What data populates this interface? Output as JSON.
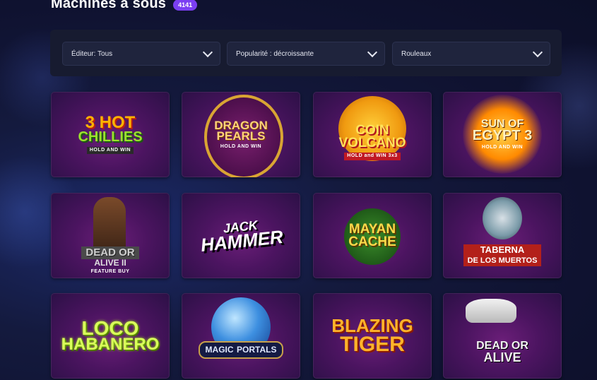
{
  "header": {
    "title": "Machines à sous",
    "count": "4141"
  },
  "filters": [
    {
      "label": "Éditeur: Tous"
    },
    {
      "label": "Popularité : décroissante"
    },
    {
      "label": "Rouleaux"
    }
  ],
  "games": [
    {
      "line1": "3 HOT",
      "line2": "CHILLIES",
      "sub": "HOLD AND WIN"
    },
    {
      "line1": "DRAGON",
      "line2": "PEARLS",
      "sub": "HOLD AND WIN"
    },
    {
      "line1": "COIN",
      "line2": "VOLCANO",
      "sub": "HOLD and WIN 3x3"
    },
    {
      "line1": "SUN OF",
      "line2": "EGYPT 3",
      "sub": "HOLD AND WIN"
    },
    {
      "line1": "DEAD OR",
      "line2": "ALIVE II",
      "sub": "FEATURE BUY"
    },
    {
      "line1": "JACK",
      "line2": "HAMMER",
      "sub": ""
    },
    {
      "line1": "MAYAN",
      "line2": "CACHE",
      "sub": ""
    },
    {
      "line1": "TABERNA",
      "line2": "DE LOS MUERTOS",
      "sub": ""
    },
    {
      "line1": "LOCO",
      "line2": "HABANERO",
      "sub": ""
    },
    {
      "line1": "MAGIC",
      "line2": "PORTALS",
      "sub": ""
    },
    {
      "line1": "BLAZING",
      "line2": "TIGER",
      "sub": ""
    },
    {
      "line1": "DEAD OR",
      "line2": "ALIVE",
      "sub": ""
    }
  ],
  "icons": {
    "filter_chevron": "chevron-down-icon"
  }
}
